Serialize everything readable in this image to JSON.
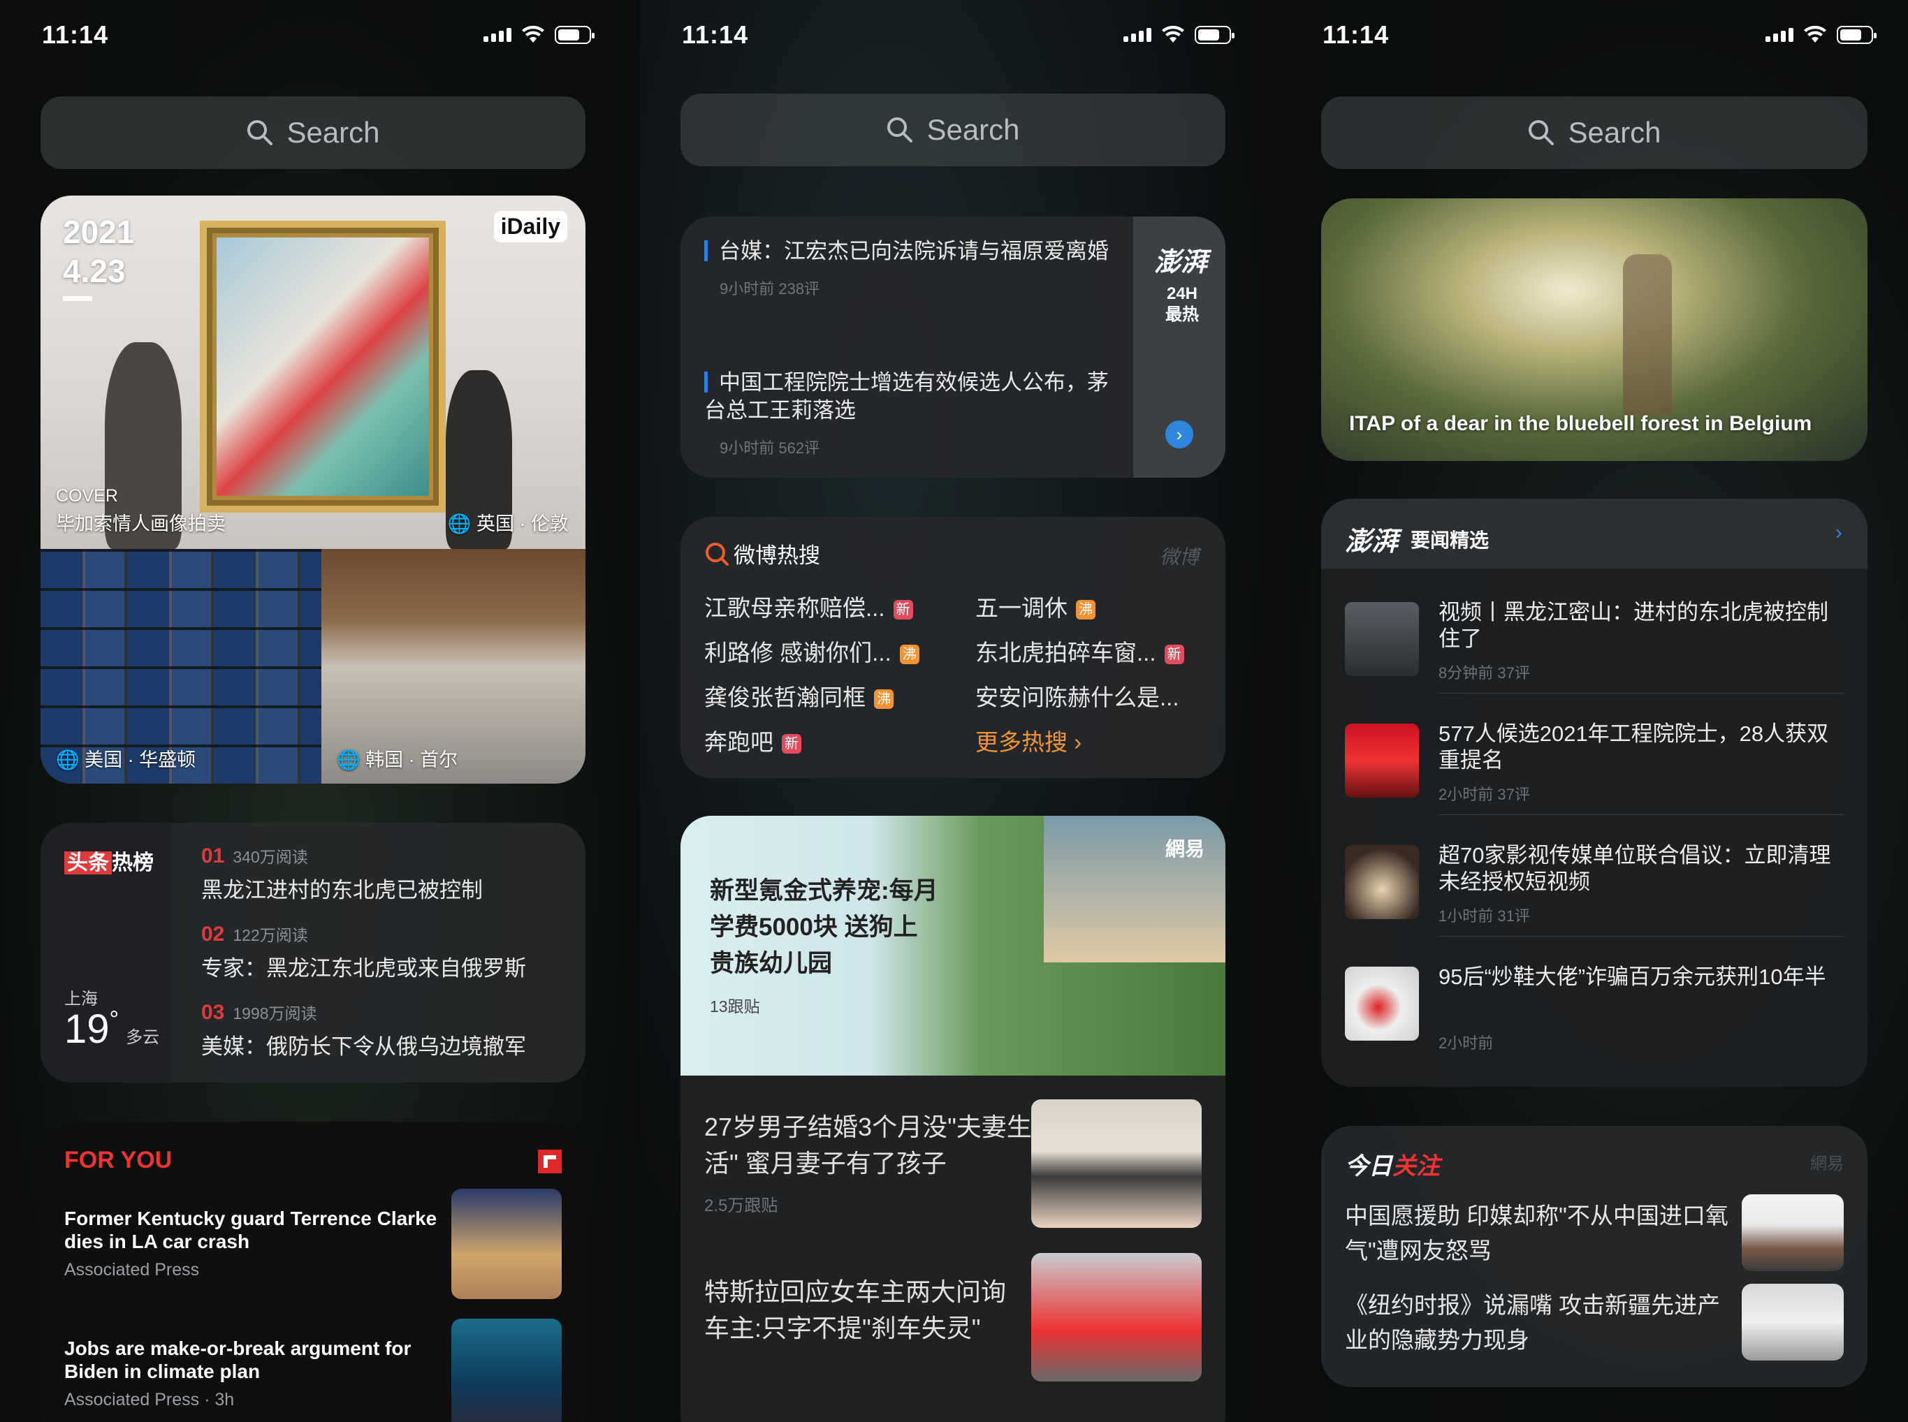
{
  "status": {
    "time": "11:14"
  },
  "search": {
    "placeholder": "Search"
  },
  "panel1": {
    "idaily": {
      "year": "2021",
      "date": "4.23",
      "badge": "iDaily",
      "cover_label": "COVER",
      "cover_title": "毕加索情人画像拍卖",
      "cover_loc": "英国 · 伦敦",
      "loc_left": "美国 · 华盛顿",
      "loc_right": "韩国 · 首尔"
    },
    "toutiao": {
      "brand_a": "头条",
      "brand_b": "热榜",
      "city": "上海",
      "temp": "19",
      "deg": "°",
      "weather": "多云",
      "items": [
        {
          "num": "01",
          "reads": "340万阅读",
          "title": "黑龙江进村的东北虎已被控制"
        },
        {
          "num": "02",
          "reads": "122万阅读",
          "title": "专家：黑龙江东北虎或来自俄罗斯"
        },
        {
          "num": "03",
          "reads": "1998万阅读",
          "title": "美媒：俄防长下令从俄乌边境撤军"
        }
      ]
    },
    "foryou": {
      "title": "FOR YOU",
      "items": [
        {
          "headline": "Former Kentucky guard Terrence Clarke dies in LA car crash",
          "source": "Associated Press"
        },
        {
          "headline": "Jobs are make-or-break argument for Biden in climate plan",
          "source": "Associated Press · 3h"
        }
      ]
    }
  },
  "panel2": {
    "thepaper": {
      "logo": "澎湃",
      "side_a": "24H",
      "side_b": "最热",
      "items": [
        {
          "title": "台媒：江宏杰已向法院诉请与福原爱离婚",
          "meta": "9小时前  238评"
        },
        {
          "title": "中国工程院院士增选有效候选人公布，茅台总工王莉落选",
          "meta": "9小时前  562评"
        }
      ]
    },
    "weibo": {
      "title": "微博热搜",
      "watermark": "微博",
      "more": "更多热搜",
      "left": [
        {
          "text": "江歌母亲称赔偿...",
          "tag": "新",
          "type": "new"
        },
        {
          "text": "利路修 感谢你们...",
          "tag": "沸",
          "type": "hot"
        },
        {
          "text": "龚俊张哲瀚同框",
          "tag": "沸",
          "type": "hot"
        },
        {
          "text": "奔跑吧",
          "tag": "新",
          "type": "new"
        }
      ],
      "right": [
        {
          "text": "五一调休",
          "tag": "沸",
          "type": "hot"
        },
        {
          "text": "东北虎拍碎车窗...",
          "tag": "新",
          "type": "new"
        },
        {
          "text": "安安问陈赫什么是...",
          "tag": "",
          "type": ""
        }
      ]
    },
    "netease": {
      "logo": "網易",
      "lead_title": "新型氪金式养宠:每月学费5000块 送狗上贵族幼儿园",
      "lead_meta": "13跟贴",
      "items": [
        {
          "title": "27岁男子结婚3个月没\"夫妻生活\" 蜜月妻子有了孩子",
          "meta": "2.5万跟贴"
        },
        {
          "title": "特斯拉回应女车主两大问询 车主:只字不提\"刹车失灵\"",
          "meta": ""
        }
      ]
    }
  },
  "panel3": {
    "photo": {
      "caption": "ITAP of a dear in the bluebell forest in Belgium"
    },
    "thepaper": {
      "logo": "澎湃",
      "title": "要闻精选",
      "items": [
        {
          "title": "视频丨黑龙江密山：进村的东北虎被控制住了",
          "meta": "8分钟前  37评"
        },
        {
          "title": "577人候选2021年工程院院士，28人获双重提名",
          "meta": "2小时前  37评"
        },
        {
          "title": "超70家影视传媒单位联合倡议：立即清理未经授权短视频",
          "meta": "1小时前  31评"
        },
        {
          "title": "95后“炒鞋大佬”诈骗百万余元获刑10年半",
          "meta": "2小时前"
        }
      ]
    },
    "today": {
      "title_a": "今日",
      "title_b": "关注",
      "watermark": "網易",
      "items": [
        {
          "title": "中国愿援助 印媒却称\"不从中国进口氧气\"遭网友怒骂"
        },
        {
          "title": "《纽约时报》说漏嘴 攻击新疆先进产业的隐藏势力现身"
        }
      ]
    }
  }
}
